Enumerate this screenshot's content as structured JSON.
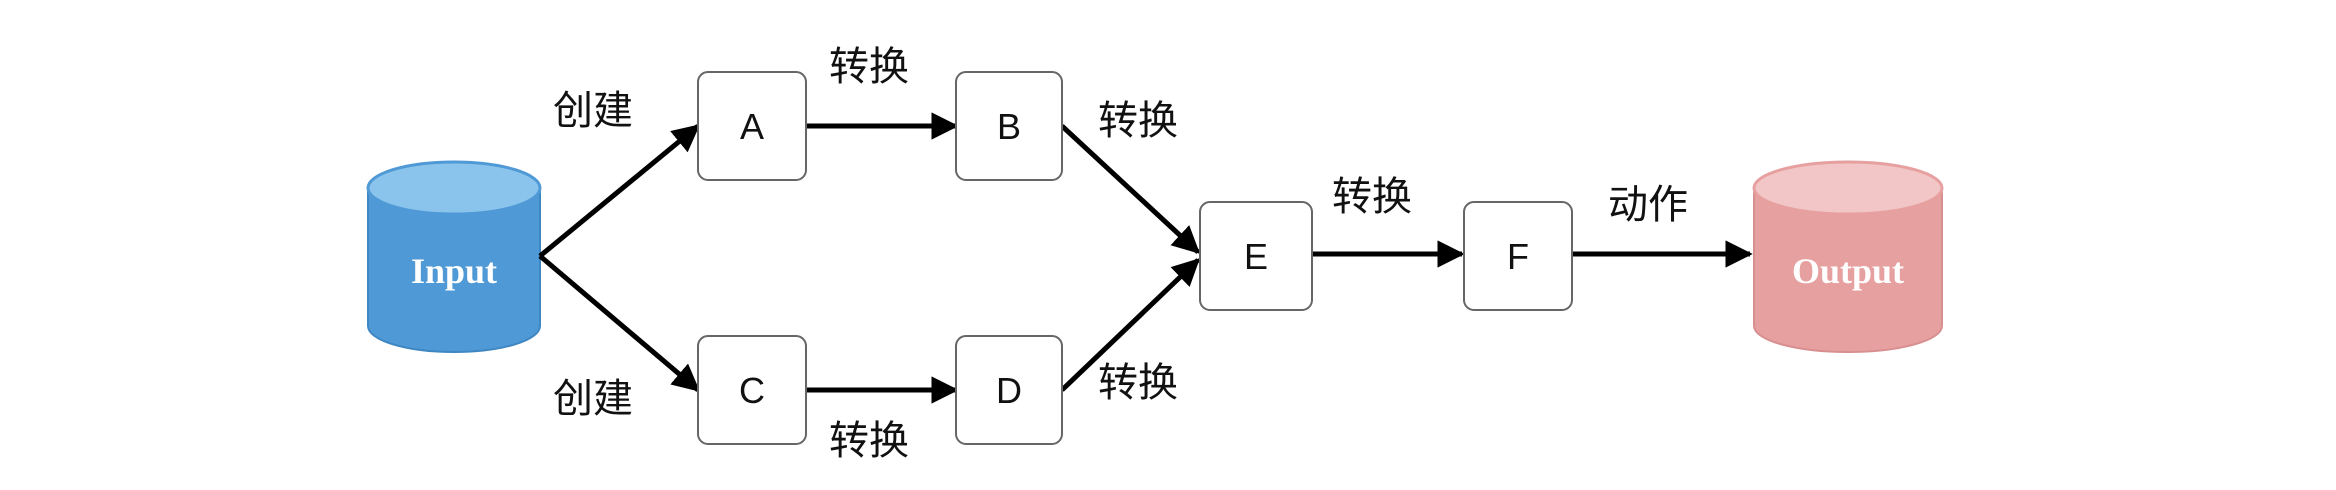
{
  "nodes": {
    "input": "Input",
    "a": "A",
    "b": "B",
    "c": "C",
    "d": "D",
    "e": "E",
    "f": "F",
    "output": "Output"
  },
  "edges": {
    "input_a": "创建",
    "input_c": "创建",
    "a_b": "转换",
    "c_d": "转换",
    "b_e": "转换",
    "d_e": "转换",
    "e_f": "转换",
    "f_output": "动作"
  },
  "colors": {
    "input_fill": "#4f9ad6",
    "input_top": "#8ac4ec",
    "output_fill": "#e7a0a0",
    "output_top": "#f2c6c6",
    "arrow": "#000000",
    "box_border": "#666666"
  }
}
